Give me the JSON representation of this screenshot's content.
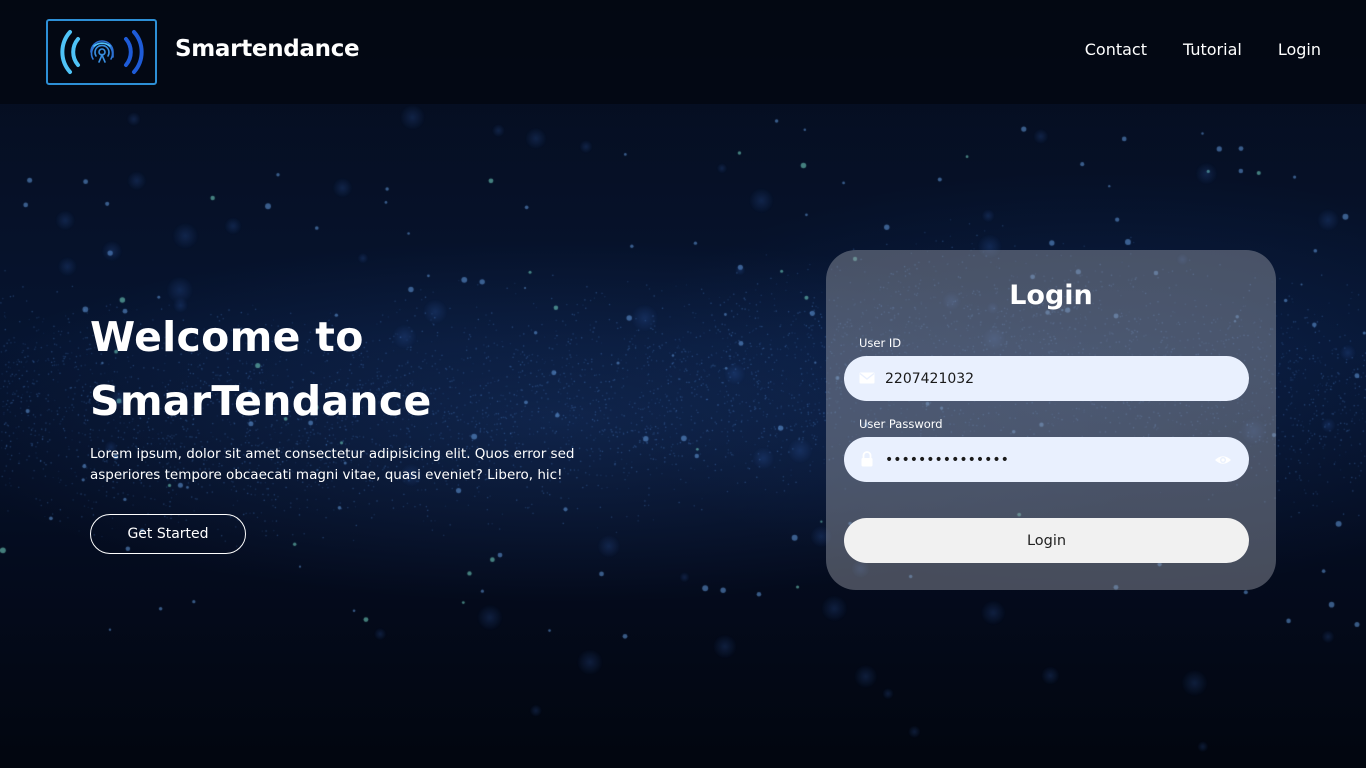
{
  "app": {
    "brand_name": "Smartendance",
    "logo_icon": "fingerprint-wireless-icon"
  },
  "nav": {
    "items": [
      {
        "label": "Contact"
      },
      {
        "label": "Tutorial"
      },
      {
        "label": "Login"
      }
    ]
  },
  "hero": {
    "title_line1": "Welcome to",
    "title_line2": "SmarTendance",
    "description": "Lorem ipsum, dolor sit amet consectetur adipisicing elit. Quos error sed asperiores tempore obcaecati magni vitae, quasi eveniet? Libero, hic!",
    "cta_label": "Get Started"
  },
  "login_form": {
    "title": "Login",
    "user_id_label": "User ID",
    "user_id_value": "2207421032",
    "user_id_icon": "envelope-icon",
    "password_label": "User Password",
    "password_value": "•••••••••••••••",
    "password_icon": "lock-icon",
    "reveal_icon": "eye-icon",
    "submit_label": "Login"
  },
  "colors": {
    "logo_light_blue": "#4fc3f7",
    "logo_dark_blue": "#1e5bd8",
    "logo_border": "#2d8fd6",
    "field_background": "#e9f0fe",
    "button_background": "#f1f1f1"
  }
}
